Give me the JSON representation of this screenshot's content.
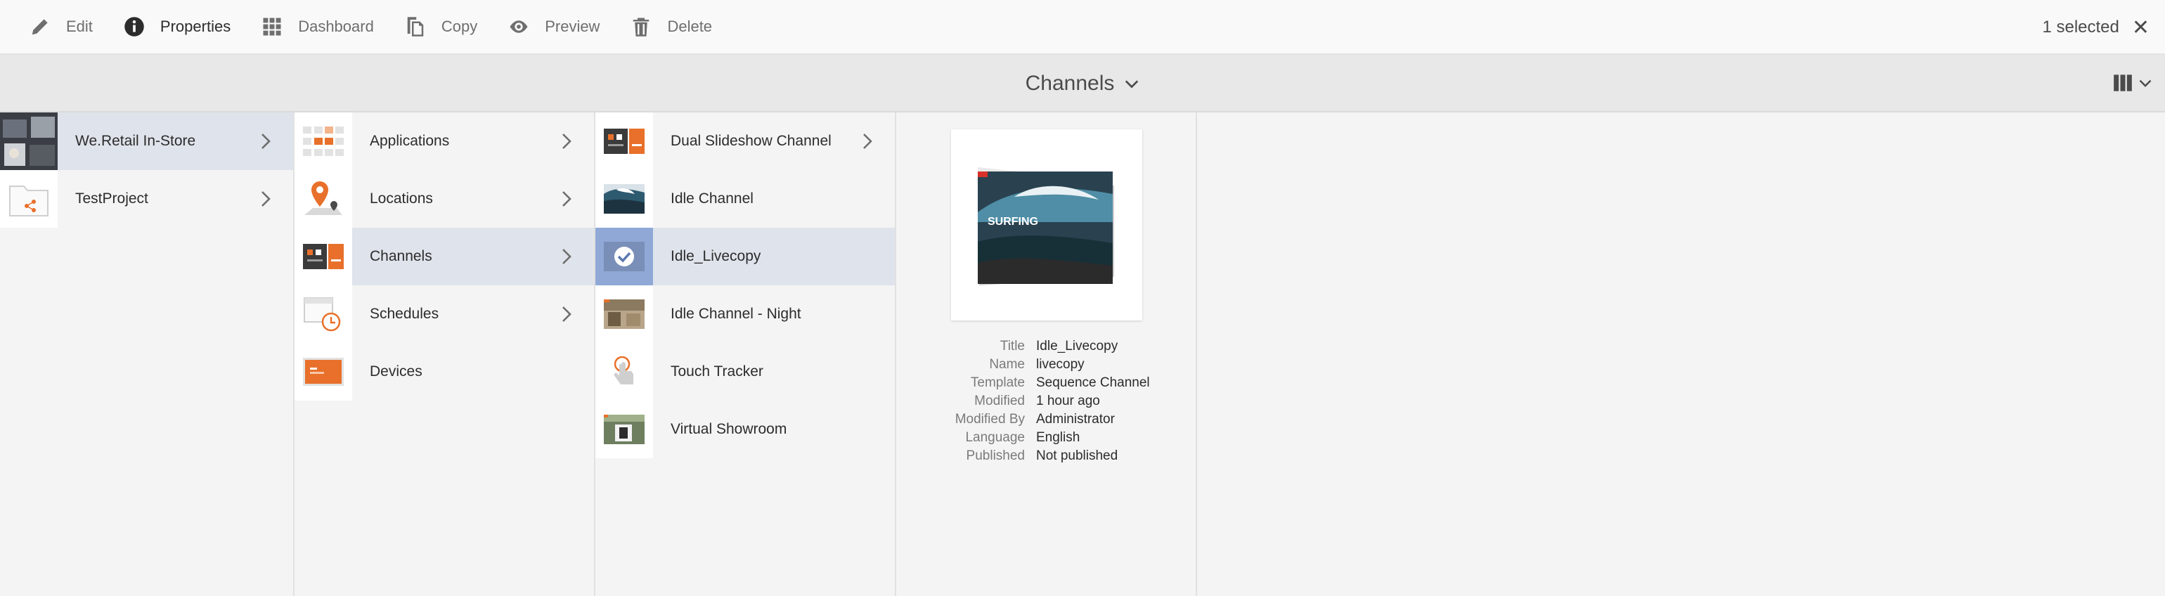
{
  "toolbar": {
    "edit": "Edit",
    "properties": "Properties",
    "dashboard": "Dashboard",
    "copy": "Copy",
    "preview": "Preview",
    "delete": "Delete",
    "selection_count": "1 selected"
  },
  "header": {
    "title": "Channels"
  },
  "column1": [
    {
      "label": "We.Retail In-Store",
      "selected": true
    },
    {
      "label": "TestProject",
      "selected": false
    }
  ],
  "column2": [
    {
      "label": "Applications"
    },
    {
      "label": "Locations"
    },
    {
      "label": "Channels"
    },
    {
      "label": "Schedules"
    },
    {
      "label": "Devices"
    }
  ],
  "column3": [
    {
      "label": "Dual Slideshow Channel"
    },
    {
      "label": "Idle Channel"
    },
    {
      "label": "Idle_Livecopy"
    },
    {
      "label": "Idle Channel - Night"
    },
    {
      "label": "Touch Tracker"
    },
    {
      "label": "Virtual Showroom"
    }
  ],
  "preview": {
    "image_text": "SURFING",
    "meta": [
      {
        "key": "Title",
        "value": "Idle_Livecopy"
      },
      {
        "key": "Name",
        "value": "livecopy"
      },
      {
        "key": "Template",
        "value": "Sequence Channel"
      },
      {
        "key": "Modified",
        "value": "1 hour ago"
      },
      {
        "key": "Modified By",
        "value": "Administrator"
      },
      {
        "key": "Language",
        "value": "English"
      },
      {
        "key": "Published",
        "value": "Not published"
      }
    ]
  },
  "colors": {
    "accent": "#e8702a",
    "selection": "#dfe3eb",
    "check_overlay": "#8fa8d6"
  }
}
